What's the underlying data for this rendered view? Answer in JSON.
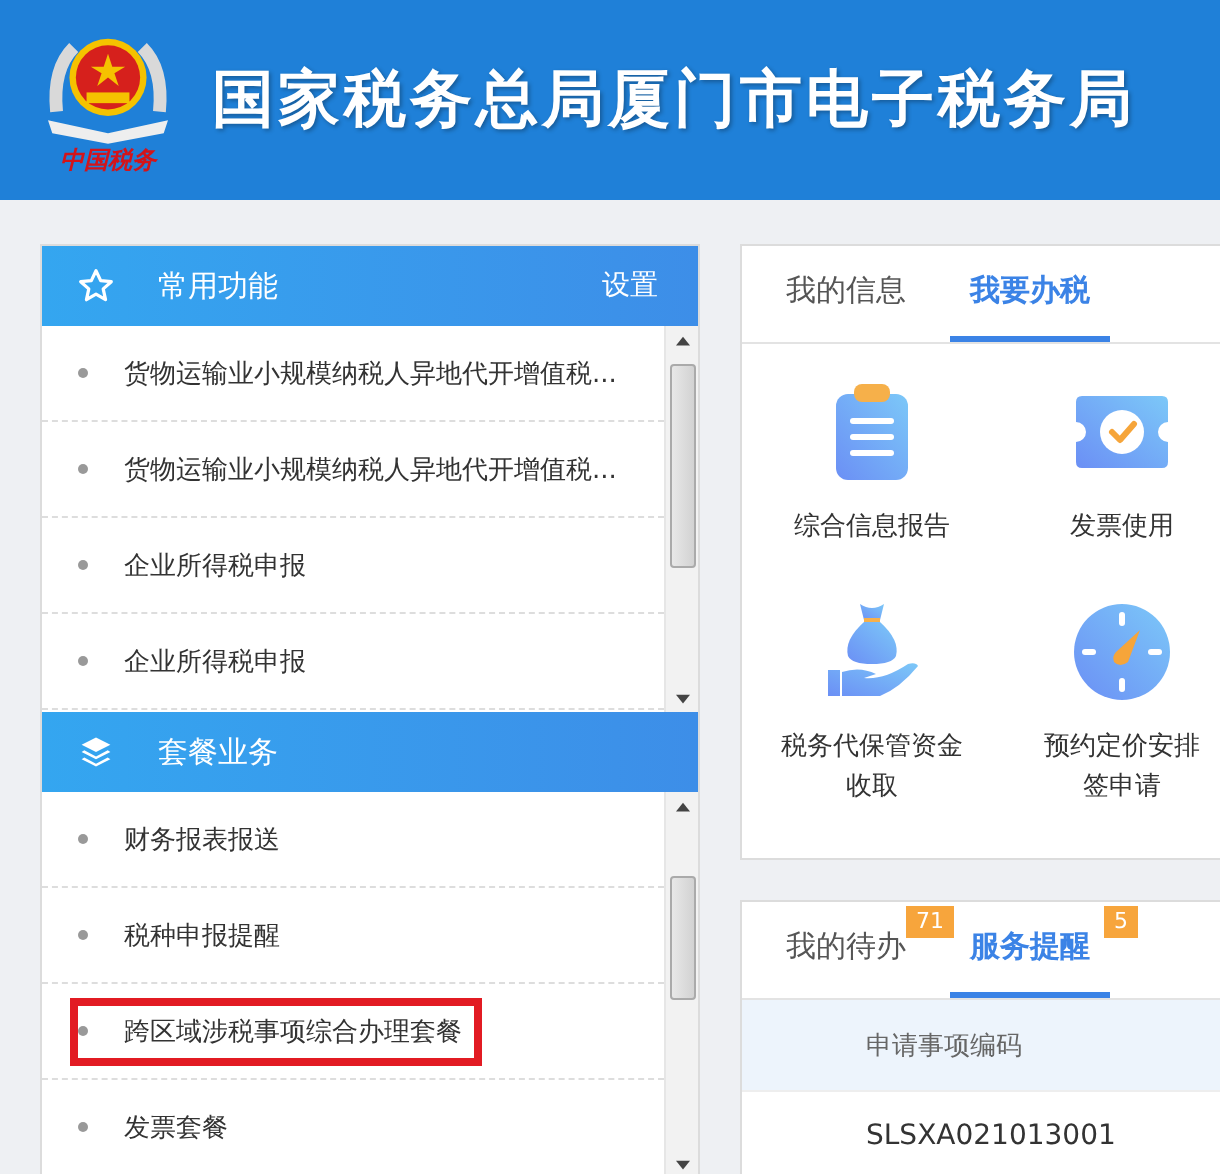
{
  "header": {
    "logo_caption": "中国税务",
    "title": "国家税务总局厦门市电子税务局"
  },
  "left": {
    "sections": [
      {
        "kind": "star",
        "title": "常用功能",
        "action": "设置",
        "items": [
          {
            "label": "货物运输业小规模纳税人异地代开增值税...",
            "highlighted": false
          },
          {
            "label": "货物运输业小规模纳税人异地代开增值税...",
            "highlighted": false
          },
          {
            "label": "企业所得税申报",
            "highlighted": false
          },
          {
            "label": "企业所得税申报",
            "highlighted": false
          }
        ]
      },
      {
        "kind": "layers",
        "title": "套餐业务",
        "items": [
          {
            "label": "财务报表报送",
            "highlighted": false
          },
          {
            "label": "税种申报提醒",
            "highlighted": false
          },
          {
            "label": "跨区域涉税事项综合办理套餐",
            "highlighted": true
          },
          {
            "label": "发票套餐",
            "highlighted": false
          }
        ]
      }
    ]
  },
  "services": {
    "tabs": [
      {
        "label": "我的信息",
        "selected": false
      },
      {
        "label": "我要办税",
        "selected": true
      }
    ],
    "items": [
      {
        "kind": "report",
        "label": "综合信息报告"
      },
      {
        "kind": "invoice",
        "label": "发票使用"
      },
      {
        "kind": "fund",
        "label": "税务代保管资金收取"
      },
      {
        "kind": "pricing",
        "label": "预约定价安排签申请"
      }
    ]
  },
  "tasks": {
    "tabs": [
      {
        "label": "我的待办",
        "badge": "71",
        "selected": false
      },
      {
        "label": "服务提醒",
        "badge": "5",
        "selected": true
      }
    ],
    "table": {
      "columns": [
        "申请事项编码"
      ],
      "rows": [
        [
          "SLSXA021013001"
        ]
      ]
    }
  }
}
